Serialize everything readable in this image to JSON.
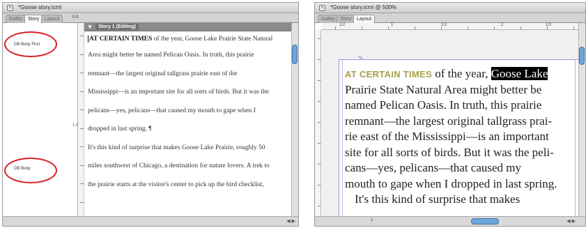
{
  "story_window": {
    "title": "*Goose story.icml",
    "tabs": [
      "Galley",
      "Story",
      "Layout"
    ],
    "active_tab": 1,
    "ruler_label": "0.0",
    "column_header": "Story 1 (Editing)",
    "styles": [
      {
        "label": "DB Body First",
        "row": 0
      },
      {
        "label": "DB Body",
        "row": 6
      }
    ],
    "depth_marker": "1.0",
    "lines": [
      {
        "lead": "AT CERTAIN TIMES",
        "text": " of the year, Goose Lake Prairie State Natural"
      },
      {
        "lead": "",
        "text": "Area might better be named Pelican Oasis. In truth, this prairie"
      },
      {
        "lead": "",
        "text": "remnant—the largest original tallgrass prairie east of the"
      },
      {
        "lead": "",
        "text": "Mississippi—is an important site for all sorts of birds. But it was the"
      },
      {
        "lead": "",
        "text": "pelicans—yes, pelicans—that caused my mouth to gape when I"
      },
      {
        "lead": "",
        "text": "dropped in last spring. ¶"
      },
      {
        "lead": "",
        "text": "It's this kind of surprise that makes Goose Lake Prairie, roughly 50"
      },
      {
        "lead": "",
        "text": "miles southwest of Chicago, a destination for nature lovers. A trek to"
      },
      {
        "lead": "",
        "text": "the prairie starts at the visitor's center to pick up the bird checklist,"
      }
    ],
    "colors": {
      "ring": "#d81f27",
      "header": "#8b8b8b",
      "scroll_thumb": "#6ea4d9"
    }
  },
  "layout_window": {
    "title": "*Goose story.icml @ 500%",
    "tabs": [
      "Galley",
      "Story",
      "Layout"
    ],
    "active_tab": 2,
    "ruler_labels": [
      "1/2",
      "1",
      "1/2",
      "2",
      "1/2"
    ],
    "page_field": "1",
    "lines": [
      [
        {
          "t": "AT CERTAIN TIMES",
          "s": "lead"
        },
        {
          "t": " of the year, ",
          "s": ""
        },
        {
          "t": "Goose Lake",
          "s": "sel"
        }
      ],
      [
        {
          "t": "Prairie State Natural Area might better be",
          "s": ""
        }
      ],
      [
        {
          "t": "named Pelican Oasis. In truth, this prairie",
          "s": ""
        }
      ],
      [
        {
          "t": "remnant—the largest original tallgrass prai-",
          "s": ""
        }
      ],
      [
        {
          "t": "rie east of the Mississippi—is an important",
          "s": ""
        }
      ],
      [
        {
          "t": "site for all sorts of birds. But it was the peli-",
          "s": ""
        }
      ],
      [
        {
          "t": "cans—yes, pelicans—that caused my",
          "s": ""
        }
      ],
      [
        {
          "t": "mouth to gape when I dropped in last spring.",
          "s": ""
        }
      ],
      [
        {
          "t": "It's this kind of surprise that makes",
          "s": "indent"
        }
      ]
    ],
    "colors": {
      "lead_in": "#a7a04a",
      "selection": "#000000",
      "frame": "#8c9fd8"
    }
  }
}
